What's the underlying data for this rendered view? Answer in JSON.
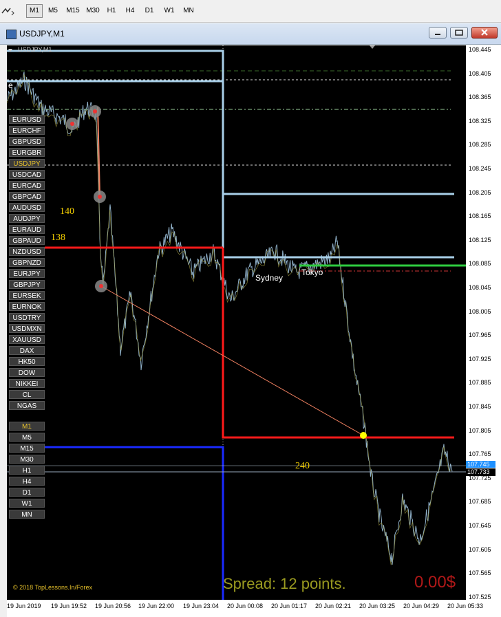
{
  "toolbar": {
    "timeframes": [
      "M1",
      "M5",
      "M15",
      "M30",
      "H1",
      "H4",
      "D1",
      "W1",
      "MN"
    ],
    "active": "M1"
  },
  "window": {
    "title": "USDJPY,M1"
  },
  "chart": {
    "symbol_tag": "USDJPY,M1",
    "corner_letter": "e",
    "symbols": [
      "EURUSD",
      "EURCHF",
      "GBPUSD",
      "EURGBR",
      "USDJPY",
      "USDCAD",
      "EURCAD",
      "GBPCAD",
      "AUDUSD",
      "AUDJPY",
      "EURAUD",
      "GBPAUD",
      "NZDUSD",
      "GBPNZD",
      "EURJPY",
      "GBPJPY",
      "EURSEK",
      "EURNOK",
      "USDTRY",
      "USDMXN",
      "XAUUSD",
      "DAX",
      "HK50",
      "DOW",
      "NIKKEI",
      "CL",
      "NGAS"
    ],
    "selected_symbol": "USDJPY",
    "tf_buttons": [
      "M1",
      "M5",
      "M15",
      "M30",
      "H1",
      "H4",
      "D1",
      "W1",
      "MN"
    ],
    "selected_tf": "M1",
    "label_140": "140",
    "label_138": "138",
    "label_240": "240",
    "session_sydney": "Sydney",
    "session_tokyo": "Tokyo",
    "copyright": "© 2018 TopLessons.In/Forex",
    "spread": "Spread: 12 points.",
    "profit": "0.00$",
    "price_labels": [
      "108.445",
      "108.405",
      "108.365",
      "108.325",
      "108.285",
      "108.245",
      "108.205",
      "108.165",
      "108.125",
      "108.085",
      "108.045",
      "108.005",
      "107.965",
      "107.925",
      "107.885",
      "107.845",
      "107.805",
      "107.765",
      "107.725",
      "107.685",
      "107.645",
      "107.605",
      "107.565",
      "107.525"
    ],
    "price_marker_ask": "107.745",
    "price_marker_bid": "107.733",
    "time_labels": [
      "19 Jun 2019",
      "19 Jun 19:52",
      "19 Jun 20:56",
      "19 Jun 22:00",
      "19 Jun 23:04",
      "20 Jun 00:08",
      "20 Jun 01:17",
      "20 Jun 02:21",
      "20 Jun 03:25",
      "20 Jun 04:29",
      "20 Jun 05:33"
    ]
  },
  "colors": {
    "background": "#000000",
    "price_line": "#8fb0c8",
    "red_level": "#ff1a1a",
    "blue_level": "#1a2aff",
    "light_blue_level": "#a8cfe8",
    "green_level": "#2ecc40",
    "label_yellow": "#f5d000",
    "spread_color": "#9a9a20",
    "profit_color": "#b01818"
  }
}
